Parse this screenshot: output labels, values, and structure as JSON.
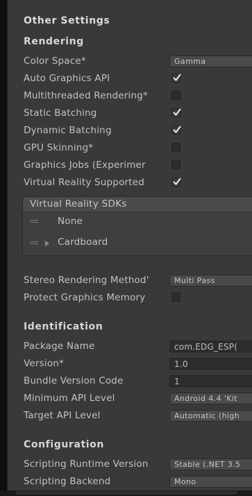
{
  "other_settings": {
    "title": "Other Settings"
  },
  "rendering": {
    "title": "Rendering",
    "color_space_label": "Color Space*",
    "color_space_value": "Gamma",
    "auto_graphics_api_label": "Auto Graphics API",
    "auto_graphics_api": true,
    "multithreaded_label": "Multithreaded Rendering*",
    "multithreaded": false,
    "static_batching_label": "Static Batching",
    "static_batching": true,
    "dynamic_batching_label": "Dynamic Batching",
    "dynamic_batching": true,
    "gpu_skinning_label": "GPU Skinning*",
    "gpu_skinning": false,
    "graphics_jobs_label": "Graphics Jobs (Experimer",
    "graphics_jobs": false,
    "vr_supported_label": "Virtual Reality Supported",
    "vr_supported": true,
    "vr_sdks": {
      "title": "Virtual Reality SDKs",
      "items": [
        "None",
        "Cardboard"
      ]
    },
    "stereo_method_label": "Stereo Rendering Method'",
    "stereo_method_value": "Multi Pass",
    "protect_memory_label": "Protect Graphics Memory",
    "protect_memory": false
  },
  "identification": {
    "title": "Identification",
    "package_name_label": "Package Name",
    "package_name_value": "com.EDG_ESP(",
    "version_label": "Version*",
    "version_value": "1.0",
    "bundle_code_label": "Bundle Version Code",
    "bundle_code_value": "1",
    "min_api_label": "Minimum API Level",
    "min_api_value": "Android 4.4 'Kit",
    "target_api_label": "Target API Level",
    "target_api_value": "Automatic (high"
  },
  "configuration": {
    "title": "Configuration",
    "scripting_runtime_label": "Scripting Runtime Version",
    "scripting_runtime_value": "Stable (.NET 3.5",
    "scripting_backend_label": "Scripting Backend",
    "scripting_backend_value": "Mono"
  }
}
